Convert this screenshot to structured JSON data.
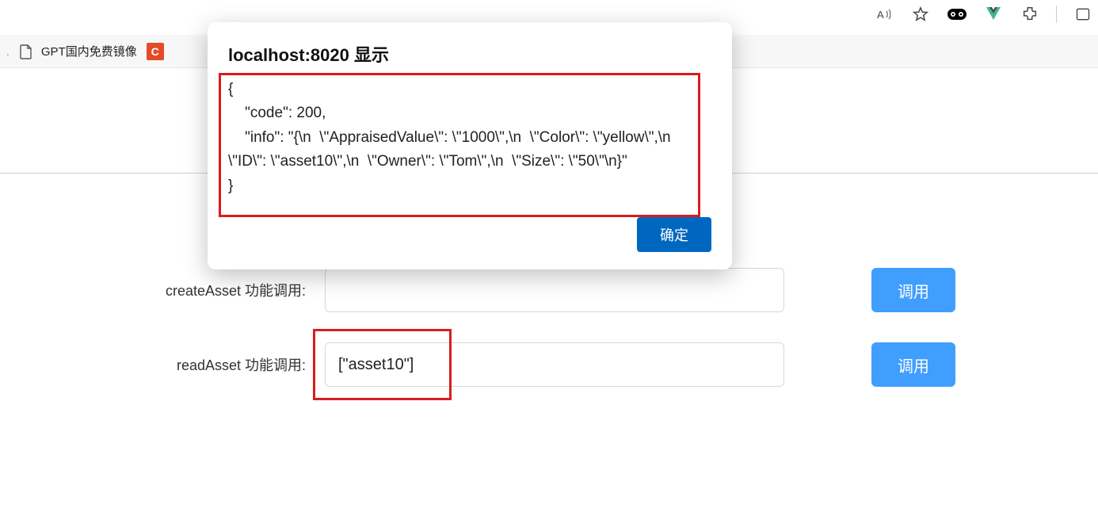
{
  "browser": {
    "bookmarks": {
      "item1": {
        "label": "GPT国内免费镜像"
      },
      "c_label": "C"
    },
    "icons": {
      "read_aloud": "read-aloud",
      "favorite": "favorite",
      "eyes": "eyes",
      "vue": "vue",
      "extensions": "extensions",
      "split": "split"
    }
  },
  "form": {
    "createAsset": {
      "label": "createAsset 功能调用:",
      "value": "",
      "button": "调用"
    },
    "readAsset": {
      "label": "readAsset 功能调用:",
      "value": "[\"asset10\"]",
      "button": "调用"
    }
  },
  "alert": {
    "title": "localhost:8020 显示",
    "body": "{\n    \"code\": 200,\n    \"info\": \"{\\n  \\\"AppraisedValue\\\": \\\"1000\\\",\\n  \\\"Color\\\": \\\"yellow\\\",\\n  \\\"ID\\\": \\\"asset10\\\",\\n  \\\"Owner\\\": \\\"Tom\\\",\\n  \\\"Size\\\": \\\"50\\\"\\n}\"\n}",
    "confirm": "确定"
  }
}
